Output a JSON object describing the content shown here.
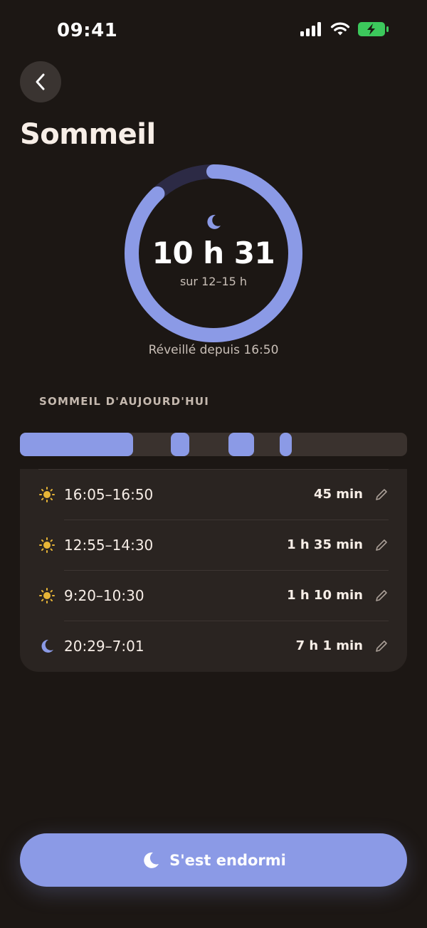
{
  "status_bar": {
    "time": "09:41"
  },
  "header": {
    "title": "Sommeil"
  },
  "summary": {
    "total": "10 h 31",
    "target": "sur 12–15 h",
    "awake_since": "Réveillé depuis 16:50",
    "progress_fraction": 0.88
  },
  "section": {
    "label": "SOMMEIL D'AUJOURD'HUI"
  },
  "sessions": [
    {
      "time": "16:05–16:50",
      "duration": "45 min",
      "icon": "sun-icon"
    },
    {
      "time": "12:55–14:30",
      "duration": "1 h 35 min",
      "icon": "sun-icon"
    },
    {
      "time": "9:20–10:30",
      "duration": "1 h 10 min",
      "icon": "sun-icon"
    },
    {
      "time": "20:29–7:01",
      "duration": "7 h 1 min",
      "icon": "moon-icon"
    }
  ],
  "cta": {
    "label": "S'est endormi"
  },
  "colors": {
    "accent": "#8b9ae6",
    "background": "#1c1714",
    "card": "#2a2421",
    "sun": "#e7b537",
    "ring_track": "#2c2a45"
  }
}
